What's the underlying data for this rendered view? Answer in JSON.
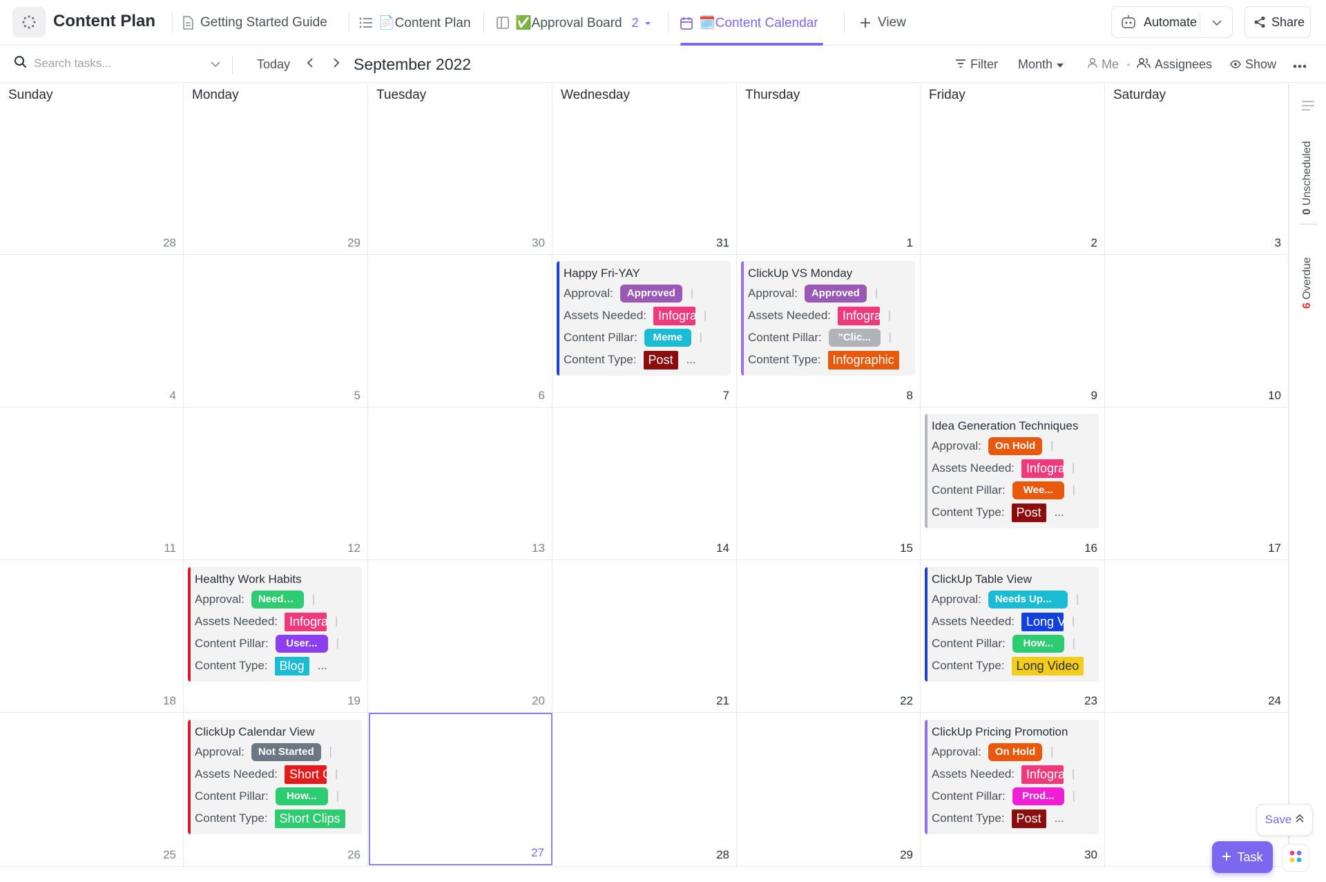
{
  "header": {
    "space_title": "Content Plan",
    "tabs": [
      {
        "label": "Getting Started Guide",
        "icon": "doc-icon"
      },
      {
        "label": "📄Content Plan",
        "icon": "list-icon"
      },
      {
        "label": "✅Approval Board",
        "icon": "board-icon",
        "count": "2"
      },
      {
        "label": "🗓️Content Calendar",
        "icon": "calendar-icon",
        "active": true
      },
      {
        "label": "View",
        "icon": "plus-icon"
      }
    ],
    "automate_label": "Automate",
    "share_label": "Share"
  },
  "toolbar": {
    "search_placeholder": "Search tasks...",
    "today_label": "Today",
    "month_title": "September 2022",
    "filter_label": "Filter",
    "range_label": "Month",
    "me_label": "Me",
    "assignees_label": "Assignees",
    "show_label": "Show"
  },
  "calendar": {
    "weekdays": [
      "Sunday",
      "Monday",
      "Tuesday",
      "Wednesday",
      "Thursday",
      "Friday",
      "Saturday"
    ],
    "weeks": [
      [
        "28",
        "29",
        "30",
        "31",
        "1",
        "2",
        "3"
      ],
      [
        "4",
        "5",
        "6",
        "7",
        "8",
        "9",
        "10"
      ],
      [
        "11",
        "12",
        "13",
        "14",
        "15",
        "16",
        "17"
      ],
      [
        "18",
        "19",
        "20",
        "21",
        "22",
        "23",
        "24"
      ],
      [
        "25",
        "26",
        "27",
        "28",
        "29",
        "30",
        ""
      ]
    ],
    "today_date": "27",
    "field_labels": {
      "approval": "Approval:",
      "assets": "Assets Needed:",
      "pillar": "Content Pillar:",
      "type": "Content Type:"
    },
    "tasks": [
      {
        "title": "Happy Fri-YAY",
        "approval": "Approved",
        "assets": "Infographic",
        "pillar": "Meme",
        "type": "Post",
        "type_more": "...",
        "bar_color": "#1c3fd6"
      },
      {
        "title": "ClickUp VS Monday",
        "approval": "Approved",
        "assets": "Infographic",
        "pillar": "\"Clic...",
        "type": "Infographic",
        "type_more": "",
        "bar_color": "#9b6cf2"
      },
      {
        "title": "Idea Generation Techniques",
        "approval": "On Hold",
        "assets": "Infographic",
        "pillar": "Wee...",
        "type": "Post",
        "type_more": "...",
        "bar_color": "#b6b8be"
      },
      {
        "title": "Healthy Work Habits",
        "approval": "Needs Re...",
        "assets": "Infographic",
        "pillar": "User...",
        "type": "Blog",
        "type_more": "...",
        "bar_color": "#d61c2c"
      },
      {
        "title": "ClickUp Table View",
        "approval": "Needs Up...",
        "assets": "Long Video",
        "pillar": "How...",
        "type": "Long Video",
        "type_more": "",
        "bar_color": "#1c3fd6"
      },
      {
        "title": "ClickUp Calendar View",
        "approval": "Not Started",
        "assets": "Short Clips",
        "pillar": "How...",
        "type": "Short Clips",
        "type_more": "",
        "bar_color": "#d61c2c"
      },
      {
        "title": "ClickUp Pricing Promotion",
        "approval": "On Hold",
        "assets": "Infographic",
        "pillar": "Prod...",
        "type": "Post",
        "type_more": "...",
        "bar_color": "#9b6cf2"
      }
    ]
  },
  "rail": {
    "unscheduled_count": "0",
    "unscheduled_label": "Unscheduled",
    "overdue_count": "6",
    "overdue_label": "Overdue"
  },
  "floating": {
    "save_label": "Save",
    "task_label": "Task"
  },
  "colors": {
    "accent": "#7b68ee",
    "approved": "#9b59b6",
    "on_hold": "#e8590c",
    "needs_review": "#2ecc71",
    "needs_update": "#1abcd4",
    "not_started": "#6b7785",
    "infographic": "#f0397a",
    "long_video": "#1241e0",
    "short_clips_asset": "#e31b1b",
    "meme": "#1abcd4",
    "clickup": "#b0b3b8",
    "weekly": "#e8590c",
    "user": "#8b3ff0",
    "how_to": "#2ecc71",
    "product": "#f01fd5",
    "post": "#8b0d0d",
    "blog": "#1abcd4",
    "long_video_type": "#f4cc1b",
    "short_clips_type": "#2ecc71"
  }
}
